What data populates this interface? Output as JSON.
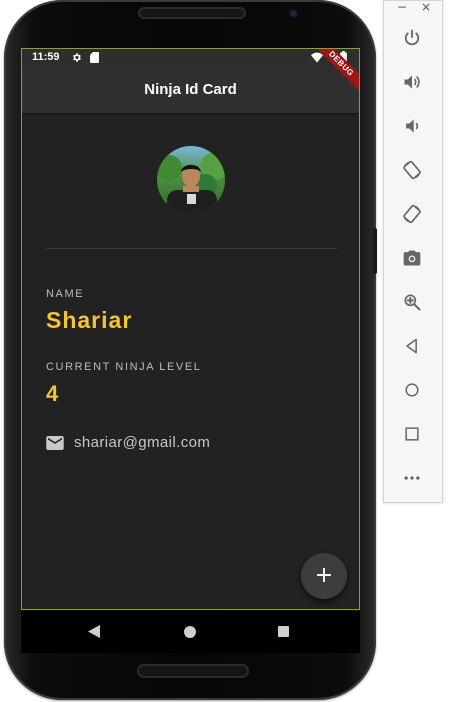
{
  "status_bar": {
    "time": "11:59",
    "icons": [
      "gear-icon",
      "sd-card-icon",
      "wifi-icon",
      "battery-icon"
    ]
  },
  "debug_banner": "DEBUG",
  "app_bar": {
    "title": "Ninja Id Card"
  },
  "profile": {
    "name_label": "NAME",
    "name": "Shariar",
    "level_label": "CURRENT NINJA LEVEL",
    "level": "4",
    "email": "shariar@gmail.com"
  },
  "fab": {
    "label": "+",
    "icon": "add-icon"
  },
  "nav_bar": {
    "buttons": [
      "back-icon",
      "home-icon",
      "recents-icon"
    ]
  },
  "emulator_toolbar": {
    "window_controls": [
      "−",
      "×"
    ],
    "buttons": [
      "power-icon",
      "volume-up-icon",
      "volume-down-icon",
      "rotate-left-icon",
      "rotate-right-icon",
      "camera-icon",
      "zoom-icon",
      "back-icon",
      "home-icon",
      "overview-icon",
      "more-icon"
    ]
  },
  "colors": {
    "screen_bg": "#222222",
    "appbar_bg": "#303030",
    "accent_yellow": "#f7c531",
    "label_grey": "#bdbdbd",
    "debug_red": "#a01616",
    "debug_border_green": "#7cab1e"
  }
}
